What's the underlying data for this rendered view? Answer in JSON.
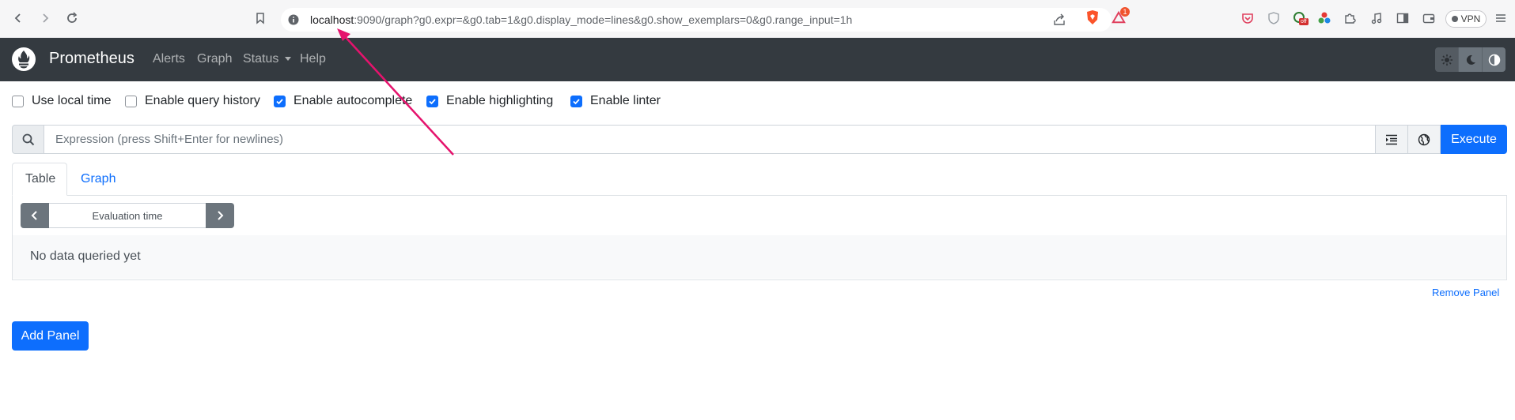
{
  "browser": {
    "url_host": "localhost",
    "url_rest": ":9090/graph?g0.expr=&g0.tab=1&g0.display_mode=lines&g0.show_exemplars=0&g0.range_input=1h",
    "vpn_label": "VPN",
    "notification_count": "1",
    "extension_badge": "off"
  },
  "navbar": {
    "brand": "Prometheus",
    "links": [
      "Alerts",
      "Graph",
      "Status",
      "Help"
    ]
  },
  "settings": {
    "use_local_time": {
      "label": "Use local time",
      "checked": false
    },
    "query_history": {
      "label": "Enable query history",
      "checked": false
    },
    "autocomplete": {
      "label": "Enable autocomplete",
      "checked": true
    },
    "highlighting": {
      "label": "Enable highlighting",
      "checked": true
    },
    "linter": {
      "label": "Enable linter",
      "checked": true
    }
  },
  "expression": {
    "placeholder": "Expression (press Shift+Enter for newlines)",
    "execute_label": "Execute"
  },
  "panel": {
    "tabs": [
      "Table",
      "Graph"
    ],
    "eval_time_placeholder": "Evaluation time",
    "no_data": "No data queried yet",
    "remove_label": "Remove Panel"
  },
  "add_panel_label": "Add Panel",
  "colors": {
    "navbar": "#343a40",
    "primary": "#0d6efd",
    "annotation_arrow": "#e5136d"
  }
}
